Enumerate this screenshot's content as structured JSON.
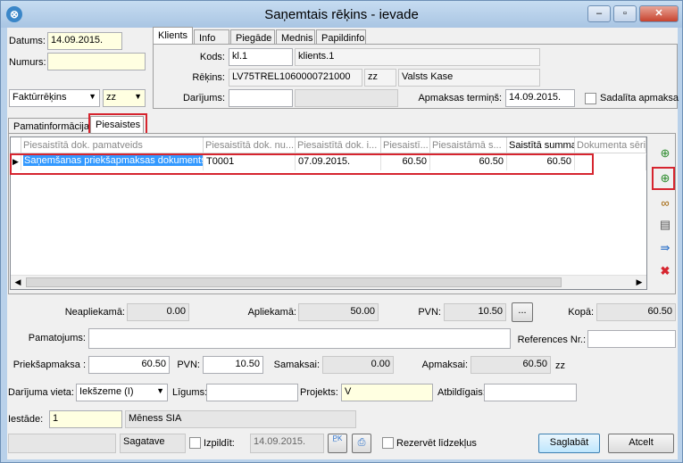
{
  "window": {
    "title": "Saņemtais rēķins - ievade",
    "min": "–",
    "max": "▫",
    "close": "✕"
  },
  "left": {
    "datums_label": "Datums:",
    "datums_value": "14.09.2015.",
    "numurs_label": "Numurs:",
    "numurs_value": "",
    "type_value": "Faktūrrēķins",
    "zz_value": "zz"
  },
  "top_tabs": [
    "Klients",
    "Info",
    "Piegāde",
    "Mednis",
    "Papildinfo"
  ],
  "client": {
    "kods_label": "Kods:",
    "kods_value": "kl.1",
    "kods_name": "klients.1",
    "rekins_label": "Rēķins:",
    "rekins_value": "LV75TREL1060000721000",
    "rekins_cur": "zz",
    "rekins_bank": "Valsts Kase",
    "darijums_label": "Darījums:",
    "darijums_value": "",
    "darijums_value2": "",
    "termins_label": "Apmaksas termiņš:",
    "termins_value": "14.09.2015.",
    "sadalita_label": "Sadalīta apmaksa"
  },
  "sub_tabs": [
    "Pamatinformācija",
    "Piesaistes"
  ],
  "grid": {
    "headers": [
      "Piesaistītā dok. pamatveids",
      "Piesaistītā dok. nu...",
      "Piesaistītā dok. i...",
      "Piesaistī...",
      "Piesaistāmā s...",
      "Saistītā summa",
      "Dokumenta sērija"
    ],
    "rows": [
      {
        "pamatveids": "Saņemšanas priekšapmaksas dokuments",
        "numurs": "T0001",
        "datums": "07.09.2015.",
        "c4": "60.50",
        "c5": "60.50",
        "summa": "60.50",
        "serija": ""
      }
    ]
  },
  "side_icons": [
    "add-linked-doc-icon",
    "add-doc-icon",
    "link-icon",
    "document-icon",
    "transfer-icon",
    "delete-icon"
  ],
  "totals": {
    "neapliekama_label": "Neapliekamā:",
    "neapliekama_value": "0.00",
    "apliekama_label": "Apliekamā:",
    "apliekama_value": "50.00",
    "pvn_label": "PVN:",
    "pvn_value": "10.50",
    "pvn_btn": "...",
    "kopa_label": "Kopā:",
    "kopa_value": "60.50"
  },
  "pamatojums_label": "Pamatojums:",
  "pamatojums_value": "",
  "references_label": "References Nr.:",
  "references_value": "",
  "prepay": {
    "label": "Priekšapmaksa :",
    "value": "60.50",
    "pvn_label": "PVN:",
    "pvn_value": "10.50",
    "samaksai_label": "Samaksai:",
    "samaksai_value": "0.00",
    "apmaksai_label": "Apmaksai:",
    "apmaksai_value": "60.50",
    "currency": "zz"
  },
  "deal": {
    "vieta_label": "Darījuma vieta:",
    "vieta_value": "Iekšzeme (I)",
    "ligums_label": "Līgums:",
    "ligums_value": "",
    "projekts_label": "Projekts:",
    "projekts_value": "V",
    "atbildigais_label": "Atbildīgais:",
    "atbildigais_value": ""
  },
  "iestade": {
    "label": "Iestāde:",
    "code": "1",
    "name": "Mēness SIA"
  },
  "bottom": {
    "status_empty": "",
    "status": "Sagatave",
    "izpildit_label": "Izpildīt:",
    "izpildit_date": "14.09.2015.",
    "rezervet_label": "Rezervēt līdzekļus",
    "save": "Saglabāt",
    "cancel": "Atcelt"
  },
  "colors": {
    "selection": "#3399ff",
    "highlight": "#d6252f",
    "accent": "#b9d1ea"
  }
}
